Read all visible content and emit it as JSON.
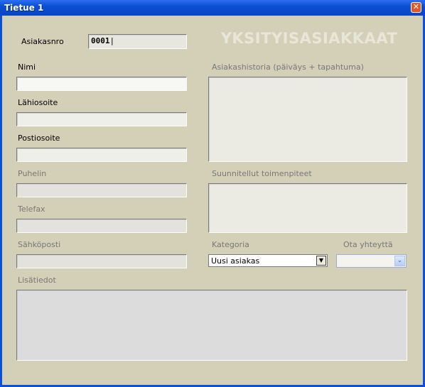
{
  "window": {
    "title": "Tietue 1",
    "close_label": "✕"
  },
  "watermark": "YKSITYISASIAKKAAT",
  "labels": {
    "asiakasnro": "Asiakasnro",
    "nimi": "Nimi",
    "lahiosoite": "Lähiosoite",
    "postiosoite": "Postiosoite",
    "puhelin": "Puhelin",
    "telefax": "Telefax",
    "sahkoposti": "Sähköposti",
    "lisatiedot": "Lisätiedot",
    "asiakashistoria": "Asiakashistoria (päiväys + tapahtuma)",
    "suunnitellut": "Suunnitellut toimenpiteet",
    "kategoria": "Kategoria",
    "ota_yhteytta": "Ota yhteyttä"
  },
  "values": {
    "asiakasnro": "0001",
    "nimi": "",
    "lahiosoite": "",
    "postiosoite": "",
    "puhelin": "",
    "telefax": "",
    "sahkoposti": "",
    "lisatiedot": "",
    "asiakashistoria": "",
    "suunnitellut": "",
    "kategoria": "Uusi asiakas",
    "ota_yhteytta": ""
  },
  "icons": {
    "dropdown": "▼",
    "dropdown2": "⌄"
  }
}
